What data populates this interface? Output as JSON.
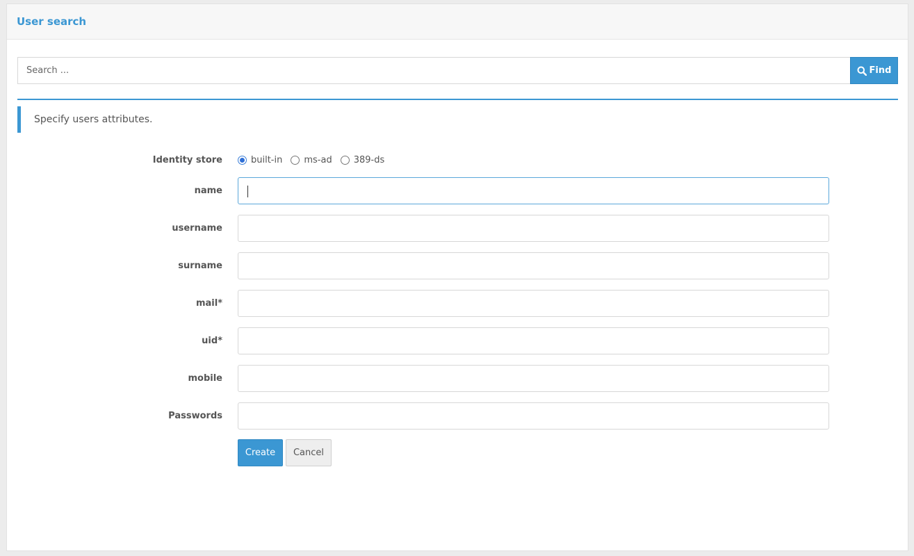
{
  "panel": {
    "title": "User search"
  },
  "search": {
    "placeholder": "Search ...",
    "button_label": "Find"
  },
  "info": {
    "text": "Specify users attributes."
  },
  "form": {
    "identity_store": {
      "label": "Identity store",
      "options": [
        "built-in",
        "ms-ad",
        "389-ds"
      ],
      "selected": "built-in"
    },
    "fields": [
      {
        "label": "name",
        "value": ""
      },
      {
        "label": "username",
        "value": ""
      },
      {
        "label": "surname",
        "value": ""
      },
      {
        "label": "mail*",
        "value": ""
      },
      {
        "label": "uid*",
        "value": ""
      },
      {
        "label": "mobile",
        "value": ""
      },
      {
        "label": "Passwords",
        "value": ""
      }
    ],
    "create_label": "Create",
    "cancel_label": "Cancel"
  },
  "colors": {
    "accent": "#3b97d3",
    "background": "#ececec"
  }
}
